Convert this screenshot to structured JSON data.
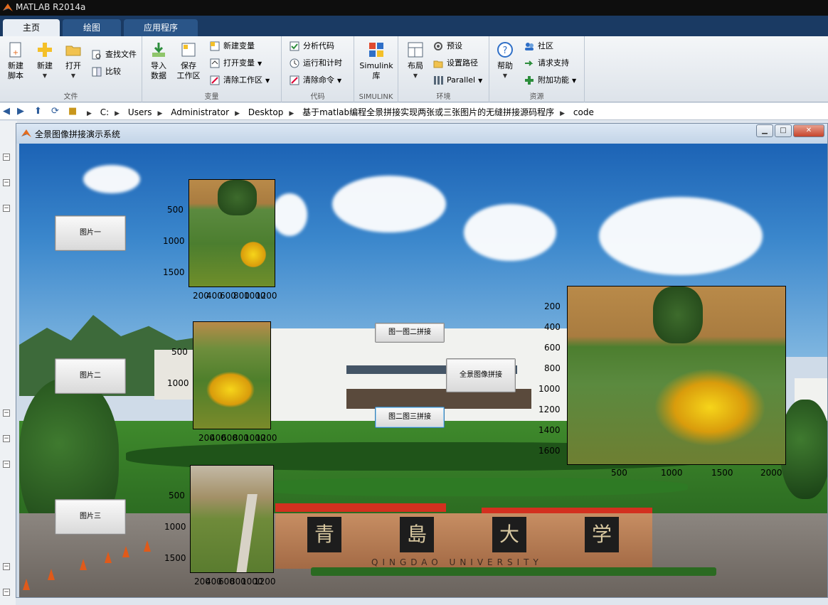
{
  "app": {
    "title": "MATLAB R2014a"
  },
  "tabs": [
    {
      "label": "主页"
    },
    {
      "label": "绘图"
    },
    {
      "label": "应用程序"
    }
  ],
  "ribbon": {
    "groups": {
      "file": "文件",
      "variable": "变量",
      "code": "代码",
      "simulink": "SIMULINK",
      "env": "环境",
      "resources": "资源"
    },
    "new_script": "新建\n脚本",
    "new": "新建",
    "open": "打开",
    "find_files": "查找文件",
    "compare": "比较",
    "import": "导入\n数据",
    "save_ws": "保存\n工作区",
    "new_var": "新建变量",
    "open_var": "打开变量",
    "clear_ws": "清除工作区",
    "analyze": "分析代码",
    "run_time": "运行和计时",
    "clear_cmd": "清除命令",
    "simulink": "Simulink\n库",
    "layout": "布局",
    "prefs": "预设",
    "set_path": "设置路径",
    "parallel": "Parallel",
    "help": "帮助",
    "community": "社区",
    "request_support": "请求支持",
    "addons": "附加功能"
  },
  "address": {
    "crumbs": [
      "C:",
      "Users",
      "Administrator",
      "Desktop",
      "基于matlab编程全景拼接实现两张或三张图片的无缝拼接源码程序",
      "code"
    ]
  },
  "figure": {
    "title": "全景图像拼接演示系统",
    "buttons": {
      "img1": "图片一",
      "img2": "图片二",
      "img3": "图片三",
      "stitch12": "图一图二拼接",
      "stitch23": "图二图三拼接",
      "panorama": "全景图像拼接"
    },
    "background_sign": {
      "chars": [
        "青",
        "島",
        "大",
        "学"
      ],
      "english": "QINGDAO UNIVERSITY"
    },
    "axes1": {
      "yticks": [
        "500",
        "1000",
        "1500"
      ],
      "xticks": [
        "200",
        "400",
        "600",
        "800",
        "1000",
        "1200"
      ]
    },
    "axes2": {
      "yticks": [
        "500",
        "1000"
      ],
      "xticks": [
        "200",
        "400",
        "600",
        "800",
        "1000",
        "1200"
      ]
    },
    "axes3": {
      "yticks": [
        "500",
        "1000",
        "1500"
      ],
      "xticks": [
        "200",
        "400",
        "600",
        "800",
        "1000",
        "1200"
      ]
    },
    "axes4": {
      "yticks": [
        "200",
        "400",
        "600",
        "800",
        "1000",
        "1200",
        "1400",
        "1600"
      ],
      "xticks": [
        "500",
        "1000",
        "1500",
        "2000"
      ]
    }
  },
  "colors": {
    "ribbon_tab_bg": "#1a3a63",
    "accent": "#2a5588"
  }
}
